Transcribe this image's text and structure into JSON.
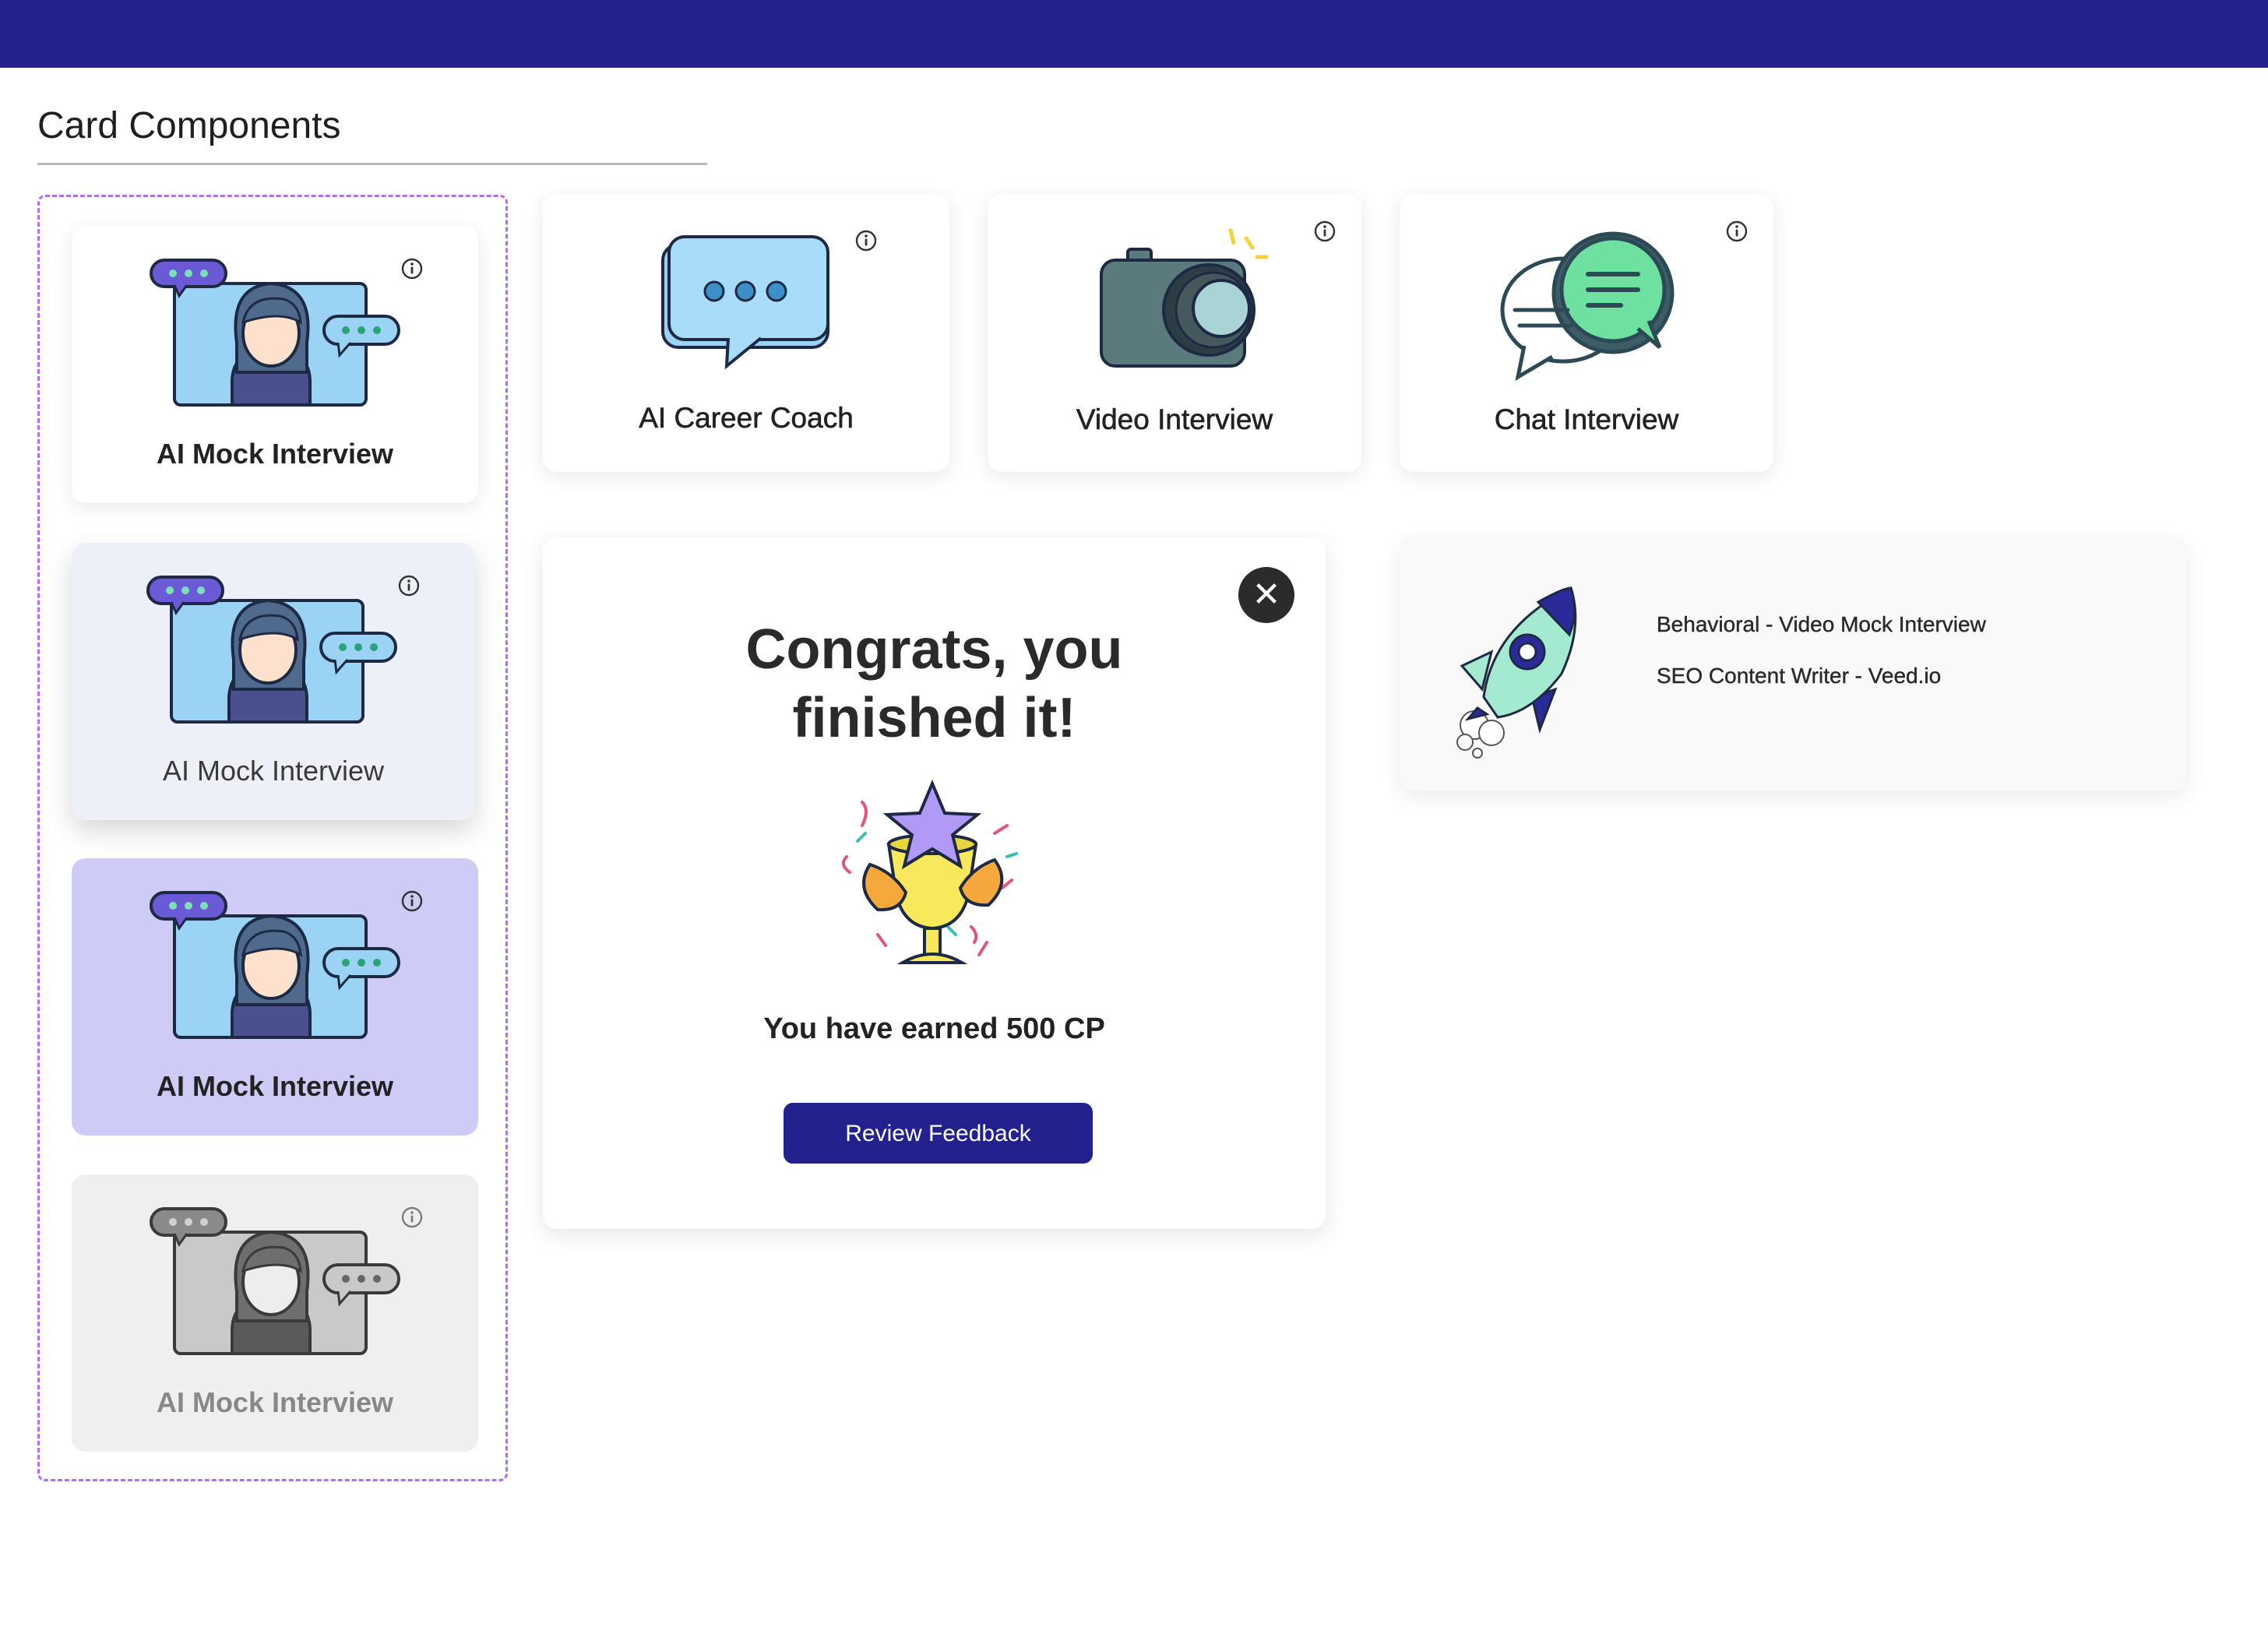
{
  "page": {
    "title": "Card Components"
  },
  "colors": {
    "brand": "#23218e",
    "selected_bg": "#cecbf6",
    "hover_bg": "#eef0f8",
    "disabled_bg": "#efefef",
    "frame_dash": "#b56df0"
  },
  "variants": [
    {
      "state": "default",
      "label": "AI Mock Interview",
      "icon": "mock-interview-illustration"
    },
    {
      "state": "hover",
      "label": "AI Mock Interview",
      "icon": "mock-interview-illustration"
    },
    {
      "state": "selected",
      "label": "AI Mock Interview",
      "icon": "mock-interview-illustration"
    },
    {
      "state": "disabled",
      "label": "AI Mock Interview",
      "icon": "mock-interview-illustration"
    }
  ],
  "cards": [
    {
      "label": "AI Career Coach",
      "icon": "chat-bubble-illustration"
    },
    {
      "label": "Video Interview",
      "icon": "camera-illustration"
    },
    {
      "label": "Chat Interview",
      "icon": "chat-bubbles-illustration"
    }
  ],
  "congrats": {
    "title_line1": "Congrats, you",
    "title_line2": "finished it!",
    "subtitle": "You have earned 500 CP",
    "button_label": "Review Feedback",
    "close_label": "✕"
  },
  "notice": {
    "line1": "Behavioral - Video Mock Interview",
    "line2": "SEO Content Writer - Veed.io"
  }
}
